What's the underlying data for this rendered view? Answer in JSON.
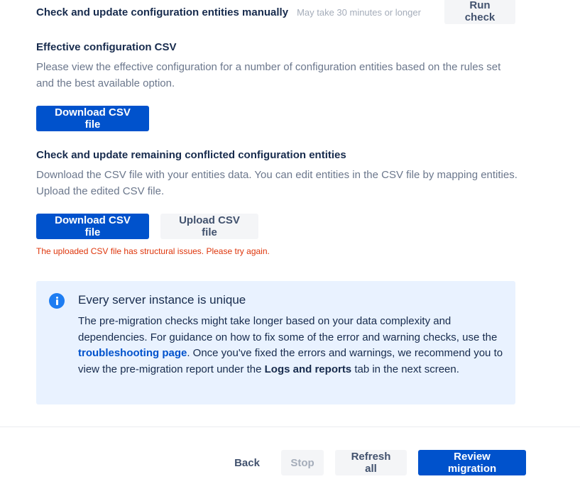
{
  "manual_check": {
    "title": "Check and update configuration entities manually",
    "note": "May take 30 minutes or longer",
    "run_check_label": "Run check"
  },
  "effective_config": {
    "title": "Effective configuration CSV",
    "description": "Please view the effective configuration for a number of configuration entities based on the rules set and the best available option.",
    "download_label": "Download CSV file"
  },
  "conflicted": {
    "title": "Check and update remaining conflicted configuration entities",
    "description": "Download the CSV file with your entities data. You can edit entities in the CSV file by mapping entities. Upload the edited CSV file.",
    "download_label": "Download CSV file",
    "upload_label": "Upload CSV file",
    "error": "The uploaded CSV file has structural issues. Please try again."
  },
  "info": {
    "icon": "info-icon",
    "title": "Every server instance is unique",
    "body_part1": "The pre-migration checks might take longer based on your data complexity and dependencies. For guidance on how to fix some of the error and warning checks, use the ",
    "link_text": "troubleshooting page",
    "body_part2": ". Once you've fixed the errors and warnings, we recommend you to view the pre-migration report under the ",
    "bold_text": "Logs and reports",
    "body_part3": " tab in the next screen."
  },
  "footer": {
    "back_label": "Back",
    "stop_label": "Stop",
    "refresh_label": "Refresh all",
    "review_label": "Review migration"
  },
  "colors": {
    "primary": "#0052cc",
    "error": "#de350b",
    "info_bg": "#e9f2ff",
    "info_icon": "#1e7df2"
  }
}
